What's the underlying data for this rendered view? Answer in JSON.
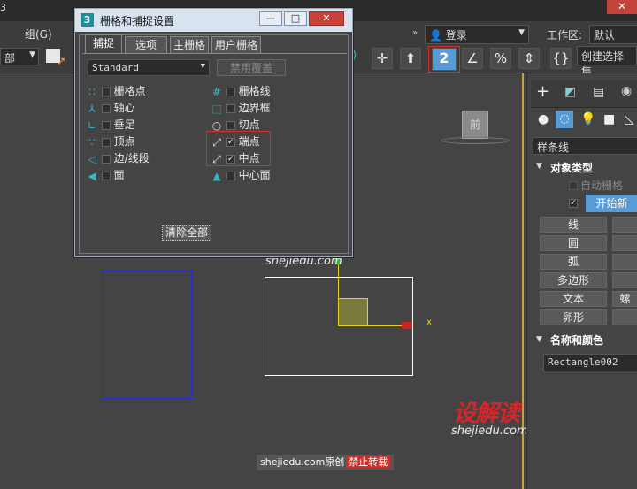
{
  "app": {
    "top_char": "3",
    "menu_group": "组(G)",
    "left_dd": "部",
    "login_label": "登录",
    "workspace_label": "工作区:",
    "workspace_value": "默认",
    "create_selection": "创建选择集"
  },
  "dialog": {
    "title": "栅格和捕捉设置",
    "icon_label": "3",
    "window_buttons": [
      "—",
      "□",
      "✕"
    ],
    "tabs": [
      "捕捉",
      "选项",
      "主栅格",
      "用户栅格"
    ],
    "preset": "Standard",
    "override_button": "禁用覆盖",
    "left_items": [
      {
        "label": "栅格点",
        "checked": false,
        "icon": "grid-points-icon",
        "glyph": "∷"
      },
      {
        "label": "轴心",
        "checked": false,
        "icon": "pivot-icon",
        "glyph": "⅄"
      },
      {
        "label": "垂足",
        "checked": false,
        "icon": "perpendicular-icon",
        "glyph": "∟"
      },
      {
        "label": "顶点",
        "checked": false,
        "icon": "vertex-icon",
        "glyph": "∵"
      },
      {
        "label": "边/线段",
        "checked": false,
        "icon": "edge-segment-icon",
        "glyph": "◁"
      },
      {
        "label": "面",
        "checked": false,
        "icon": "face-icon",
        "glyph": "◀"
      }
    ],
    "right_items": [
      {
        "label": "栅格线",
        "checked": false,
        "icon": "grid-lines-icon",
        "glyph": "#"
      },
      {
        "label": "边界框",
        "checked": false,
        "icon": "bounding-box-icon",
        "glyph": "⬚"
      },
      {
        "label": "切点",
        "checked": false,
        "icon": "tangent-icon",
        "glyph": "○"
      },
      {
        "label": "端点",
        "checked": true,
        "icon": "endpoint-icon",
        "glyph": "⤢"
      },
      {
        "label": "中点",
        "checked": true,
        "icon": "midpoint-icon",
        "glyph": "⤢"
      },
      {
        "label": "中心面",
        "checked": false,
        "icon": "center-face-icon",
        "glyph": "▲"
      }
    ],
    "clear_all": "清除全部"
  },
  "panel": {
    "splines": "样条线",
    "object_type": "对象类型",
    "auto_grid": "自动栅格",
    "start_new": "开始新",
    "buttons": [
      "线",
      "圆",
      "弧",
      "多边形",
      "文本",
      "卵形"
    ],
    "buttons_right": [
      "",
      "",
      "",
      "",
      "螺",
      ""
    ],
    "name_color": "名称和颜色",
    "name_value": "Rectangle002"
  },
  "viewport": {
    "axis_x": "x",
    "cube_label": "前"
  },
  "watermark": {
    "logo": "设解读",
    "url": "shejiedu.com",
    "credit_prefix": "shejiedu.com原创",
    "credit_suffix": "禁止转载"
  },
  "colors": {
    "accent": "#4a90d9",
    "highlight": "#d3302f",
    "selection_yellow": "#e8d020"
  }
}
